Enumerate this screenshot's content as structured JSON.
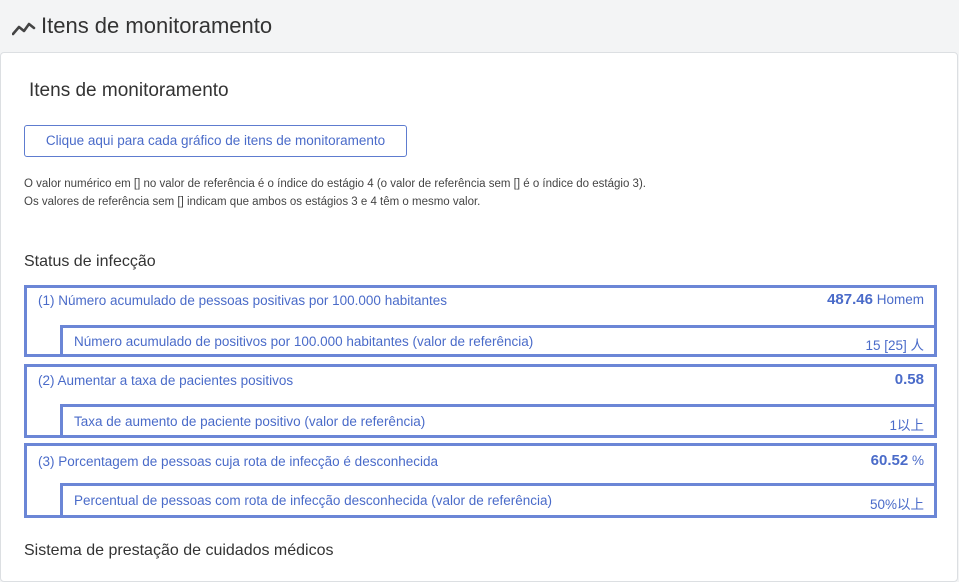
{
  "header": {
    "title": "Itens de monitoramento",
    "icon": "trend-line-icon"
  },
  "card": {
    "title": "Itens de monitoramento",
    "chart_button_label": "Clique aqui para cada gráfico de itens de monitoramento",
    "note_line1": "O valor numérico em [] no valor de referência é o índice do estágio 4 (o valor de referência sem [] é o índice do estágio 3).",
    "note_line2": "Os valores de referência sem [] indicam que ambos os estágios 3 e 4 têm o mesmo valor."
  },
  "infection": {
    "section_title": "Status de infecção",
    "items": [
      {
        "label": "(1) Número acumulado de pessoas positivas por 100.000 habitantes",
        "value": "487.46",
        "unit": "Homem",
        "ref_label": "Número acumulado de positivos por 100.000 habitantes (valor de referência)",
        "ref_value": "15 [25] 人"
      },
      {
        "label": "(2) Aumentar a taxa de pacientes positivos",
        "value": "0.58",
        "unit": "",
        "ref_label": "Taxa de aumento de paciente positivo (valor de referência)",
        "ref_value": "1以上"
      },
      {
        "label": "(3) Porcentagem de pessoas cuja rota de infecção é desconhecida",
        "value": "60.52",
        "unit": "%",
        "ref_label": "Percentual de pessoas com rota de infecção desconhecida (valor de referência)",
        "ref_value": "50%以上"
      }
    ]
  },
  "medical": {
    "section_title": "Sistema de prestação de cuidados médicos"
  },
  "colors": {
    "accent": "#4a6bc9",
    "border": "#6b86d6",
    "background": "#f3f4f5"
  }
}
